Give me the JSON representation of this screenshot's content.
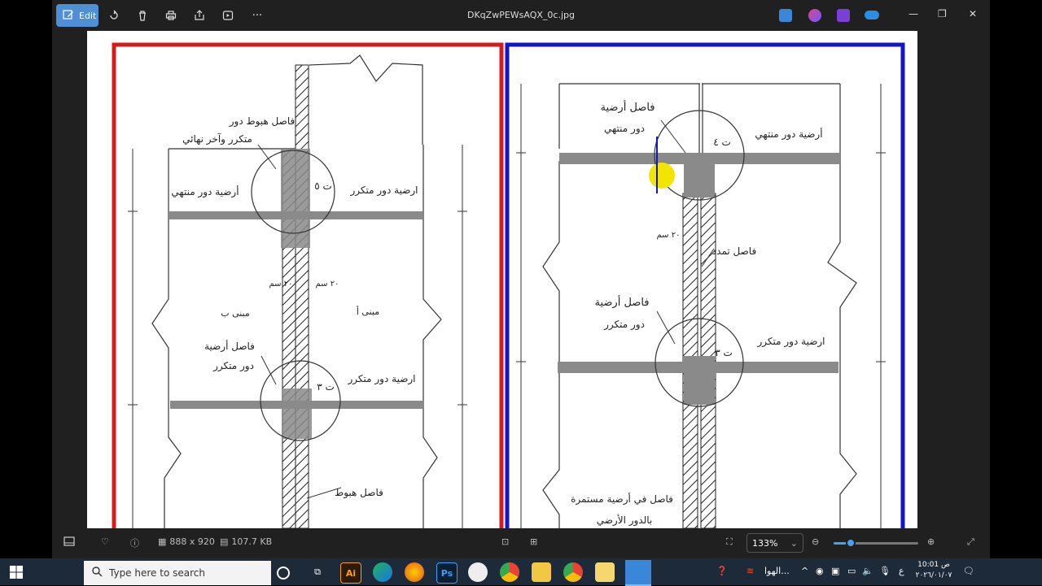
{
  "app": {
    "title": "DKqZwPEWsAQX_0c.jpg",
    "edit_label": "Edit"
  },
  "drawing": {
    "left": {
      "label_top": "فاصل هبوط دور",
      "label_top2": "متكرر وآخر نهائي",
      "floor_end": "أرضية دور منتهي",
      "floor_rep_top": "ارضية دور متكرر",
      "circle5": "ت ٥",
      "building_b": "مبنى ب",
      "building_a": "مبنى أ",
      "sep_floor": "فاصل أرضية",
      "sep_floor2": "دور متكرر",
      "floor_rep": "ارضية دور متكرر",
      "circle3": "ت ٣",
      "sep_settle": "فاصل هبوط",
      "dim1": "٢٠ سم",
      "dim2": "٢٠ سم"
    },
    "right": {
      "sep_floor": "فاصل أرضية",
      "sep_floor2": "دور منتهي",
      "floor_end": "أرضية دور منتهي",
      "circle4": "ت ٤",
      "sep_expand": "فاصل تمدد",
      "dim": "٢٠ سم",
      "sep_floor_rep": "فاصل أرضية",
      "sep_floor_rep2": "دور متكرر",
      "floor_rep": "ارضية دور متكرر",
      "circle3": "ت ٣",
      "sep_ground": "فاصل في أرضية مستمرة",
      "sep_ground2": "بالدور الأرضي"
    }
  },
  "status": {
    "dimensions": "888 x 920",
    "size": "107.7 KB",
    "zoom": "133%",
    "zoom_fraction": 0.2
  },
  "taskbar": {
    "search_placeholder": "Type here to search",
    "weather": "الهوا...",
    "time": "10:01 ص",
    "date": "٢٠٢٦/٠١/٠٧",
    "lang": "ع"
  },
  "colors": {
    "accent": "#4f8fd6",
    "left_border": "#d41c1c",
    "right_border": "#1515c8"
  }
}
